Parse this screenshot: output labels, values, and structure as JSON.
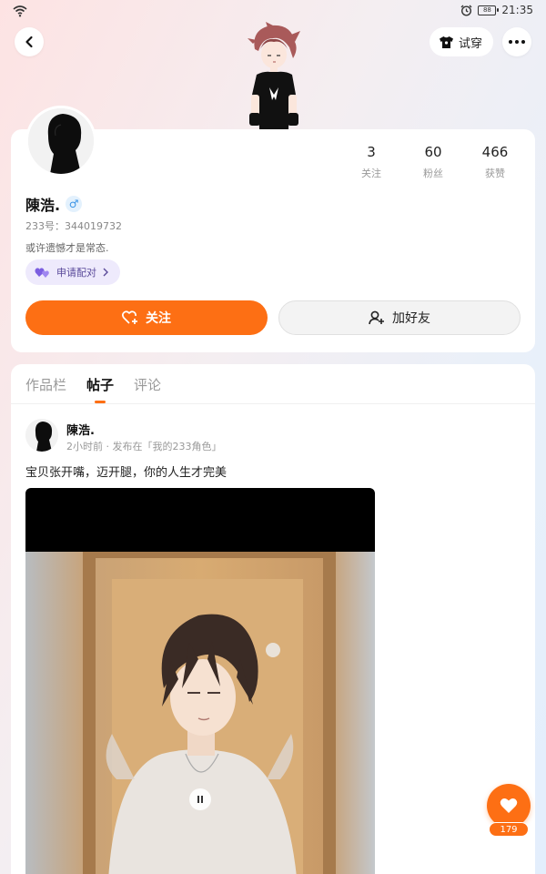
{
  "status_bar": {
    "time": "21:35",
    "battery": "88",
    "icons": [
      "wifi-icon",
      "alarm-icon",
      "battery-icon"
    ]
  },
  "nav": {
    "back_icon": "chevron-left-icon",
    "tryon_label": "试穿",
    "tryon_icon": "tshirt-icon",
    "more_icon": "more-dots-icon"
  },
  "profile": {
    "name": "陳浩.",
    "gender_symbol": "♂",
    "uid": "233号：344019732",
    "bio": "或许遗憾才是常态.",
    "pair_label": "申请配对",
    "stats": [
      {
        "value": "3",
        "label": "关注"
      },
      {
        "value": "60",
        "label": "粉丝"
      },
      {
        "value": "466",
        "label": "获赞"
      }
    ],
    "follow_label": "关注",
    "add_friend_label": "加好友"
  },
  "tabs": [
    {
      "label": "作品栏",
      "active": false
    },
    {
      "label": "帖子",
      "active": true
    },
    {
      "label": "评论",
      "active": false
    }
  ],
  "post": {
    "author": "陳浩.",
    "meta": "2小时前 · 发布在「我的233角色」",
    "text": "宝贝张开嘴，迈开腿，你的人生才完美"
  },
  "like": {
    "count": "179"
  },
  "colors": {
    "accent": "#fd6f14",
    "pair_bg": "#eeeafc",
    "gender": "#3b94e6"
  }
}
